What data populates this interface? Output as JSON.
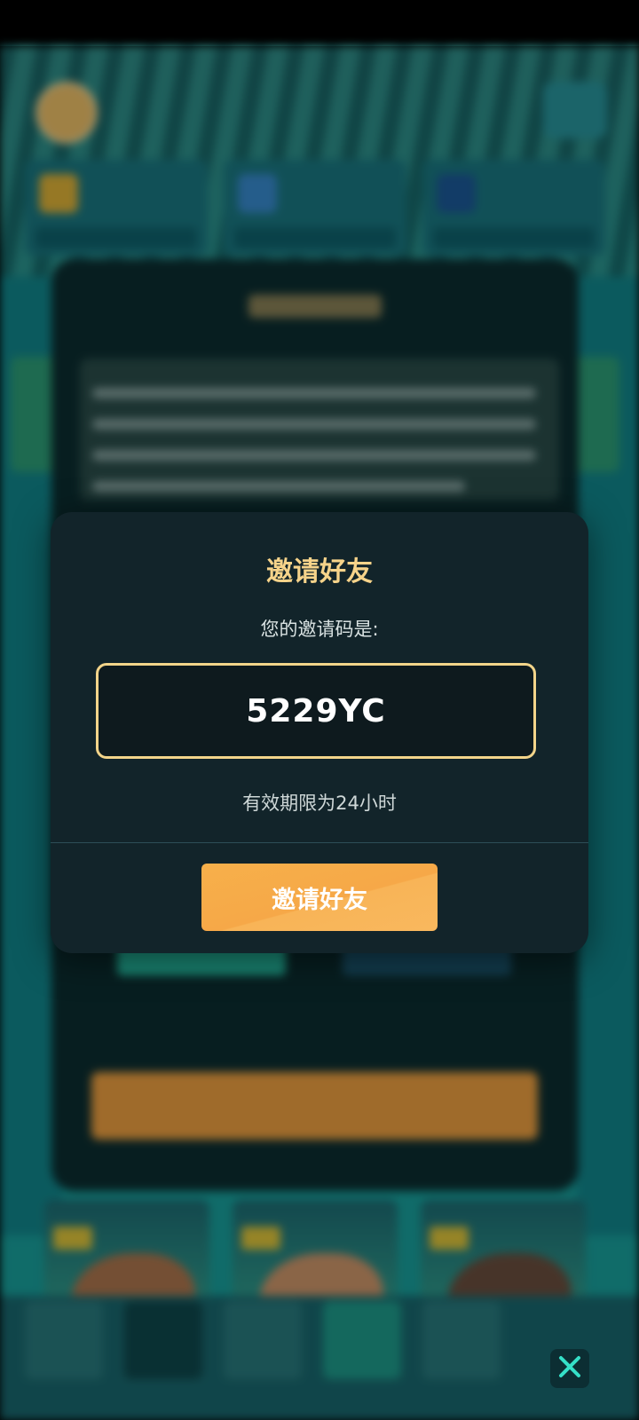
{
  "invite_modal": {
    "title": "邀请好友",
    "code_label": "您的邀请码是:",
    "invite_code": "5229YC",
    "validity_note": "有效期限为24小时",
    "invite_button": "邀请好友"
  },
  "colors": {
    "title_gold": "#f6d38a",
    "code_border": "#f2d48a",
    "button_orange": "#f6a848",
    "modal_bg": "#12242a"
  },
  "icons": [
    "close-icon"
  ]
}
